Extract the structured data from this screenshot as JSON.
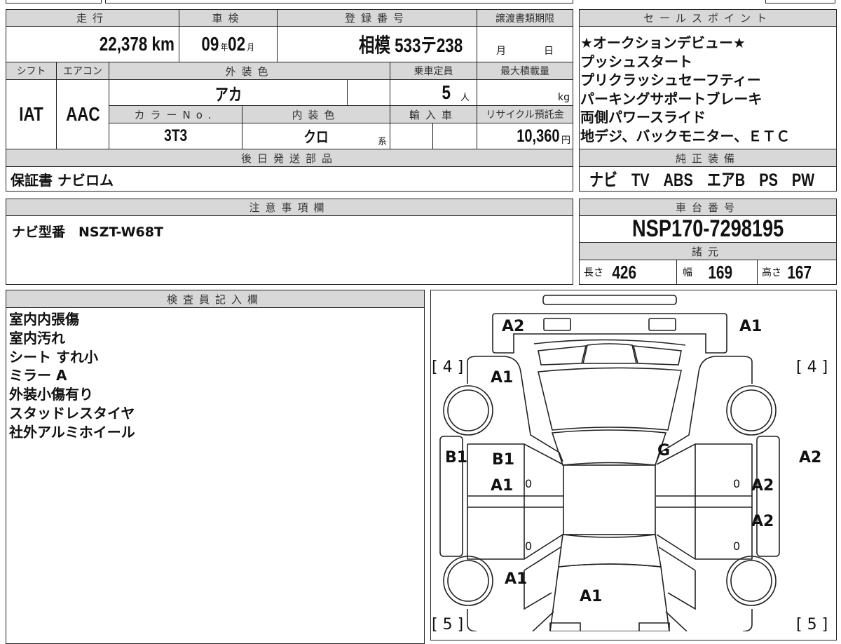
{
  "vehicle_table": {
    "mileage_label": "走行",
    "mileage_value": "22,378",
    "mileage_unit": "km",
    "inspection_label": "車検",
    "inspection_year": "09",
    "year_unit": "年",
    "inspection_month": "02",
    "month_unit": "月",
    "registration_label": "登録番号",
    "registration_value": "相模 533テ238",
    "transfer_deadline_label": "譲渡書類期限",
    "transfer_month_unit": "月",
    "transfer_day_unit": "日",
    "shift_label": "シフト",
    "shift_value": "IAT",
    "aircon_label": "エアコン",
    "aircon_value": "AAC",
    "exterior_color_label": "外装色",
    "exterior_color_value": "アカ",
    "capacity_label": "乗車定員",
    "capacity_value": "5",
    "capacity_unit": "人",
    "max_load_label": "最大積載量",
    "max_load_unit": "kg",
    "color_no_label": "カラーNo.",
    "color_no_value": "3T3",
    "interior_color_label": "内装色",
    "interior_color_value": "クロ",
    "interior_color_suffix": "系",
    "import_label": "輸入車",
    "recycle_label": "リサイクル預託金",
    "recycle_value": "10,360",
    "recycle_unit": "円",
    "later_parts_label": "後日発送部品",
    "later_parts_value": "保証書 ナビロム"
  },
  "notes": {
    "label": "注意事項欄",
    "value": "ナビ型番　NSZT-W68T"
  },
  "sales_points": {
    "label": "セールスポイント",
    "items": [
      "★オークションデビュー★",
      "プッシュスタート",
      "プリクラッシュセーフティー",
      "パーキングサポートブレーキ",
      "両側パワースライド",
      "地デジ、バックモニター、ＥＴＣ"
    ]
  },
  "factory_equipment": {
    "label": "純正装備",
    "value": "ナビ　TV　ABS　エアB　PS　PW"
  },
  "chassis": {
    "label": "車台番号",
    "value": "NSP170-7298195"
  },
  "specs": {
    "label": "諸元",
    "length_label": "長さ",
    "length_value": "426",
    "width_label": "幅",
    "width_value": "169",
    "height_label": "高さ",
    "height_value": "167"
  },
  "inspector": {
    "label": "検査員記入欄",
    "items": [
      "室内内張傷",
      "室内汚れ",
      "シート すれ小",
      "ミラー A",
      "外装小傷有り",
      "スタッドレスタイヤ",
      "社外アルミホイール"
    ]
  },
  "diagram": {
    "marks": {
      "front_left": "A2",
      "front_right": "A1",
      "tire_fl": "[ 4 ]",
      "tire_fr": "[ 4 ]",
      "fender_l": "A1",
      "sill_l": "B1",
      "door_fl_1": "B1",
      "door_fl_2": "A1",
      "windshield": "G",
      "sill_r": "A2",
      "door_fr": "A2",
      "door_rr": "A2",
      "quarter_l": "A1",
      "trunk": "A1",
      "tire_rl": "[ 5 ]",
      "tire_rr": "[ 5 ]",
      "zero": "0"
    }
  }
}
